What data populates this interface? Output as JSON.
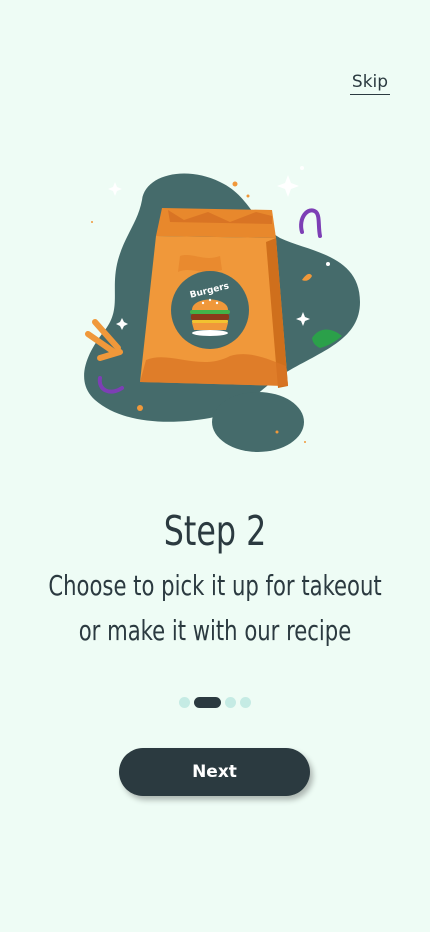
{
  "header": {
    "skip_label": "Skip"
  },
  "illustration": {
    "bag_label": "Burgers",
    "icons": [
      "burger-bag-icon",
      "burger-icon",
      "fries-icon",
      "pepper-icon",
      "sparkle-icon"
    ]
  },
  "content": {
    "title": "Step 2",
    "subtitle_line1": "Choose to pick it up for takeout",
    "subtitle_line2": "or make it with our recipe"
  },
  "pagination": {
    "total": 4,
    "current": 2
  },
  "footer": {
    "next_label": "Next"
  },
  "colors": {
    "background": "#eefcf5",
    "primary": "#2b3a40",
    "accent": "#f0983a",
    "dot_inactive": "#c5ebe4",
    "blob": "#456b6b"
  }
}
